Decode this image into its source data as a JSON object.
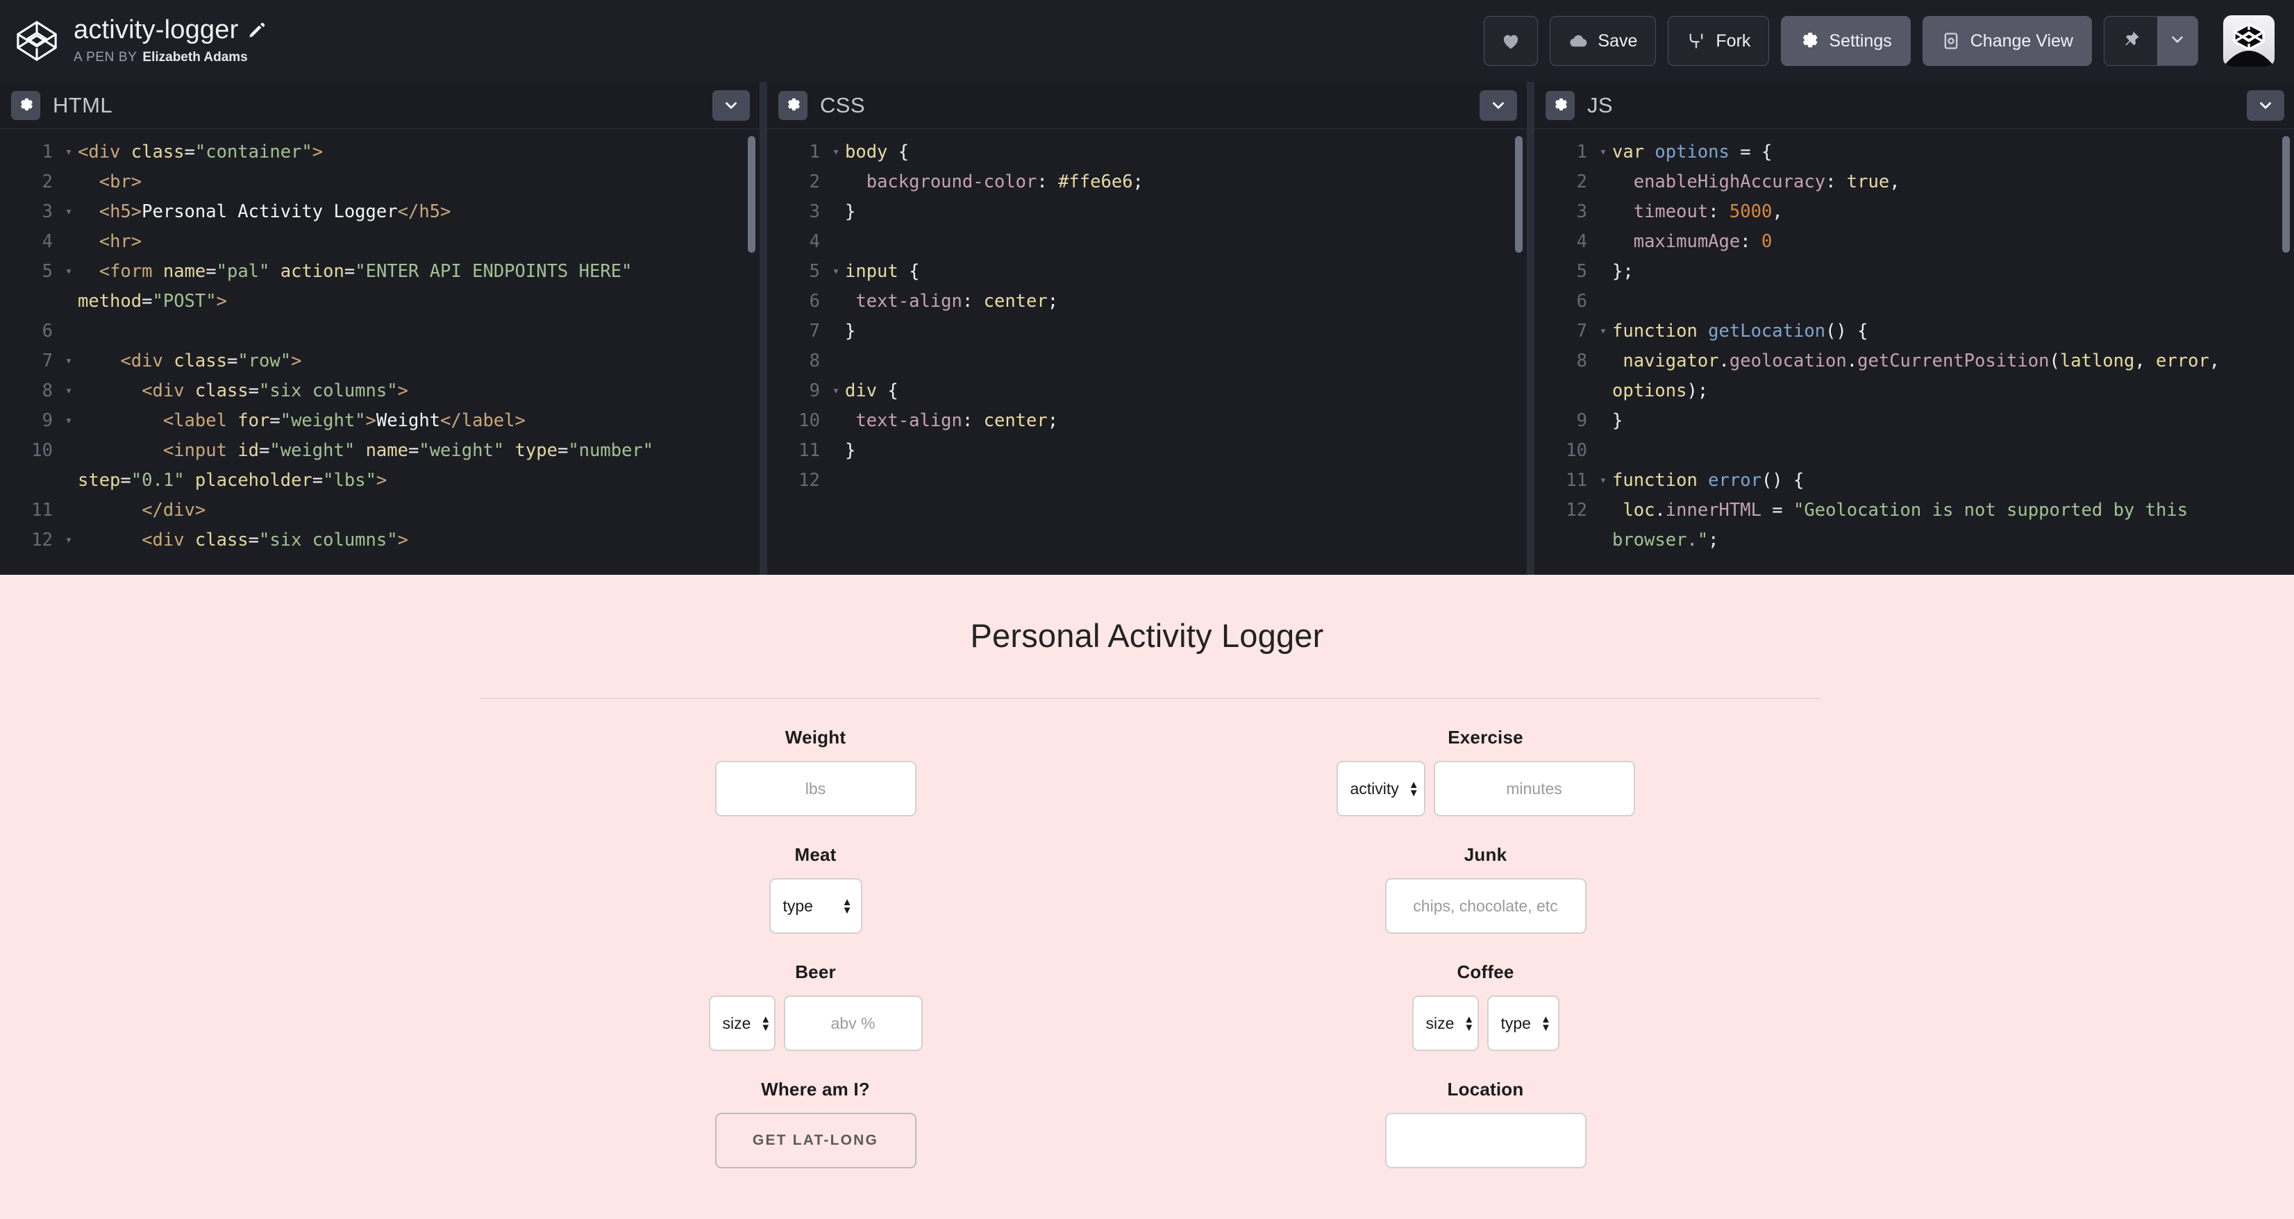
{
  "header": {
    "pen_title": "activity-logger",
    "byline_prefix": "A PEN BY",
    "author": "Elizabeth Adams",
    "edit_icon": "pencil-icon",
    "logo_icon": "codepen-logo-icon",
    "actions": {
      "love_label": "",
      "love_icon": "heart-icon",
      "save_label": "Save",
      "save_icon": "cloud-icon",
      "fork_label": "Fork",
      "fork_icon": "fork-icon",
      "settings_label": "Settings",
      "settings_icon": "gear-icon",
      "change_view_label": "Change View",
      "change_view_icon": "layout-icon",
      "pin_icon": "pin-icon",
      "pin_caret_icon": "chevron-down-icon",
      "avatar_label": "avatar"
    }
  },
  "editors": [
    {
      "id": "html",
      "title": "HTML",
      "gear_icon": "gear-icon",
      "collapse_icon": "chevron-down-icon",
      "lines": [
        {
          "n": "1",
          "fold": true,
          "tokens": [
            [
              "t-tag",
              "<div "
            ],
            [
              "t-attr",
              "class"
            ],
            [
              "t-punct",
              "="
            ],
            [
              "t-str",
              "\"container\""
            ],
            [
              "t-tag",
              ">"
            ]
          ]
        },
        {
          "n": "2",
          "fold": false,
          "tokens": [
            [
              "t-punct",
              "  "
            ],
            [
              "t-tag",
              "<br>"
            ]
          ]
        },
        {
          "n": "3",
          "fold": true,
          "tokens": [
            [
              "t-punct",
              "  "
            ],
            [
              "t-tag",
              "<h5>"
            ],
            [
              "t-txt",
              "Personal Activity Logger"
            ],
            [
              "t-tag",
              "</h5>"
            ]
          ]
        },
        {
          "n": "4",
          "fold": false,
          "tokens": [
            [
              "t-punct",
              "  "
            ],
            [
              "t-tag",
              "<hr>"
            ]
          ]
        },
        {
          "n": "5",
          "fold": true,
          "tokens": [
            [
              "t-punct",
              "  "
            ],
            [
              "t-tag",
              "<form "
            ],
            [
              "t-attr",
              "name"
            ],
            [
              "t-punct",
              "="
            ],
            [
              "t-str",
              "\"pal\""
            ],
            [
              "t-punct",
              " "
            ],
            [
              "t-attr",
              "action"
            ],
            [
              "t-punct",
              "="
            ],
            [
              "t-str",
              "\"ENTER API ENDPOINTS HERE\""
            ],
            [
              "t-punct",
              " "
            ],
            [
              "t-attr",
              "method"
            ],
            [
              "t-punct",
              "="
            ],
            [
              "t-str",
              "\"POST\""
            ],
            [
              "t-tag",
              ">"
            ]
          ]
        },
        {
          "n": "6",
          "fold": false,
          "tokens": [
            [
              "t-punct",
              ""
            ]
          ]
        },
        {
          "n": "7",
          "fold": true,
          "tokens": [
            [
              "t-punct",
              "    "
            ],
            [
              "t-tag",
              "<div "
            ],
            [
              "t-attr",
              "class"
            ],
            [
              "t-punct",
              "="
            ],
            [
              "t-str",
              "\"row\""
            ],
            [
              "t-tag",
              ">"
            ]
          ]
        },
        {
          "n": "8",
          "fold": true,
          "tokens": [
            [
              "t-punct",
              "      "
            ],
            [
              "t-tag",
              "<div "
            ],
            [
              "t-attr",
              "class"
            ],
            [
              "t-punct",
              "="
            ],
            [
              "t-str",
              "\"six columns\""
            ],
            [
              "t-tag",
              ">"
            ]
          ]
        },
        {
          "n": "9",
          "fold": true,
          "tokens": [
            [
              "t-punct",
              "        "
            ],
            [
              "t-tag",
              "<label "
            ],
            [
              "t-attr",
              "for"
            ],
            [
              "t-punct",
              "="
            ],
            [
              "t-str",
              "\"weight\""
            ],
            [
              "t-tag",
              ">"
            ],
            [
              "t-txt",
              "Weight"
            ],
            [
              "t-tag",
              "</label>"
            ]
          ]
        },
        {
          "n": "10",
          "fold": false,
          "tokens": [
            [
              "t-punct",
              "        "
            ],
            [
              "t-tag",
              "<input "
            ],
            [
              "t-attr",
              "id"
            ],
            [
              "t-punct",
              "="
            ],
            [
              "t-str",
              "\"weight\""
            ],
            [
              "t-punct",
              " "
            ],
            [
              "t-attr",
              "name"
            ],
            [
              "t-punct",
              "="
            ],
            [
              "t-str",
              "\"weight\""
            ],
            [
              "t-punct",
              " "
            ],
            [
              "t-attr",
              "type"
            ],
            [
              "t-punct",
              "="
            ],
            [
              "t-str",
              "\"number\""
            ],
            [
              "t-punct",
              " "
            ],
            [
              "t-attr",
              "step"
            ],
            [
              "t-punct",
              "="
            ],
            [
              "t-str",
              "\"0.1\""
            ],
            [
              "t-punct",
              " "
            ],
            [
              "t-attr",
              "placeholder"
            ],
            [
              "t-punct",
              "="
            ],
            [
              "t-str",
              "\"lbs\""
            ],
            [
              "t-tag",
              ">"
            ]
          ]
        },
        {
          "n": "11",
          "fold": false,
          "tokens": [
            [
              "t-punct",
              "      "
            ],
            [
              "t-tag",
              "</div>"
            ]
          ]
        },
        {
          "n": "12",
          "fold": true,
          "tokens": [
            [
              "t-punct",
              "      "
            ],
            [
              "t-tag",
              "<div "
            ],
            [
              "t-attr",
              "class"
            ],
            [
              "t-punct",
              "="
            ],
            [
              "t-str",
              "\"six columns\""
            ],
            [
              "t-tag",
              ">"
            ]
          ]
        }
      ]
    },
    {
      "id": "css",
      "title": "CSS",
      "gear_icon": "gear-icon",
      "collapse_icon": "chevron-down-icon",
      "lines": [
        {
          "n": "1",
          "fold": true,
          "tokens": [
            [
              "t-sel",
              "body"
            ],
            [
              "t-punct",
              " {"
            ]
          ]
        },
        {
          "n": "2",
          "fold": false,
          "tokens": [
            [
              "t-punct",
              "  "
            ],
            [
              "t-prop",
              "background-color"
            ],
            [
              "t-punct",
              ": "
            ],
            [
              "t-val",
              "#ffe6e6"
            ],
            [
              "t-punct",
              ";"
            ]
          ]
        },
        {
          "n": "3",
          "fold": false,
          "tokens": [
            [
              "t-punct",
              "}"
            ]
          ]
        },
        {
          "n": "4",
          "fold": false,
          "tokens": [
            [
              "t-punct",
              ""
            ]
          ]
        },
        {
          "n": "5",
          "fold": true,
          "tokens": [
            [
              "t-sel",
              "input"
            ],
            [
              "t-punct",
              " {"
            ]
          ]
        },
        {
          "n": "6",
          "fold": false,
          "tokens": [
            [
              "t-punct",
              " "
            ],
            [
              "t-prop",
              "text-align"
            ],
            [
              "t-punct",
              ": "
            ],
            [
              "t-val",
              "center"
            ],
            [
              "t-punct",
              ";"
            ]
          ]
        },
        {
          "n": "7",
          "fold": false,
          "tokens": [
            [
              "t-punct",
              "}"
            ]
          ]
        },
        {
          "n": "8",
          "fold": false,
          "tokens": [
            [
              "t-punct",
              ""
            ]
          ]
        },
        {
          "n": "9",
          "fold": true,
          "tokens": [
            [
              "t-sel",
              "div"
            ],
            [
              "t-punct",
              " {"
            ]
          ]
        },
        {
          "n": "10",
          "fold": false,
          "tokens": [
            [
              "t-punct",
              " "
            ],
            [
              "t-prop",
              "text-align"
            ],
            [
              "t-punct",
              ": "
            ],
            [
              "t-val",
              "center"
            ],
            [
              "t-punct",
              ";"
            ]
          ]
        },
        {
          "n": "11",
          "fold": false,
          "tokens": [
            [
              "t-punct",
              "}"
            ]
          ]
        },
        {
          "n": "12",
          "fold": false,
          "tokens": [
            [
              "t-punct",
              ""
            ]
          ]
        }
      ]
    },
    {
      "id": "js",
      "title": "JS",
      "gear_icon": "gear-icon",
      "collapse_icon": "chevron-down-icon",
      "lines": [
        {
          "n": "1",
          "fold": true,
          "tokens": [
            [
              "t-kw",
              "var "
            ],
            [
              "t-fn",
              "options"
            ],
            [
              "t-punct",
              " = {"
            ]
          ]
        },
        {
          "n": "2",
          "fold": false,
          "tokens": [
            [
              "t-punct",
              "  "
            ],
            [
              "t-mem",
              "enableHighAccuracy"
            ],
            [
              "t-punct",
              ": "
            ],
            [
              "t-kw",
              "true"
            ],
            [
              "t-punct",
              ","
            ]
          ]
        },
        {
          "n": "3",
          "fold": false,
          "tokens": [
            [
              "t-punct",
              "  "
            ],
            [
              "t-mem",
              "timeout"
            ],
            [
              "t-punct",
              ": "
            ],
            [
              "t-num",
              "5000"
            ],
            [
              "t-punct",
              ","
            ]
          ]
        },
        {
          "n": "4",
          "fold": false,
          "tokens": [
            [
              "t-punct",
              "  "
            ],
            [
              "t-mem",
              "maximumAge"
            ],
            [
              "t-punct",
              ": "
            ],
            [
              "t-num",
              "0"
            ]
          ]
        },
        {
          "n": "5",
          "fold": false,
          "tokens": [
            [
              "t-punct",
              "};"
            ]
          ]
        },
        {
          "n": "6",
          "fold": false,
          "tokens": [
            [
              "t-punct",
              ""
            ]
          ]
        },
        {
          "n": "7",
          "fold": true,
          "tokens": [
            [
              "t-kw",
              "function "
            ],
            [
              "t-fn",
              "getLocation"
            ],
            [
              "t-punct",
              "() {"
            ]
          ]
        },
        {
          "n": "8",
          "fold": false,
          "tokens": [
            [
              "t-punct",
              " "
            ],
            [
              "t-ident",
              "navigator"
            ],
            [
              "t-punct",
              "."
            ],
            [
              "t-mem",
              "geolocation"
            ],
            [
              "t-punct",
              "."
            ],
            [
              "t-mem",
              "getCurrentPosition"
            ],
            [
              "t-punct",
              "("
            ],
            [
              "t-ident",
              "latlong"
            ],
            [
              "t-punct",
              ", "
            ],
            [
              "t-ident",
              "error"
            ],
            [
              "t-punct",
              ", "
            ],
            [
              "t-ident",
              "options"
            ],
            [
              "t-punct",
              ");"
            ]
          ]
        },
        {
          "n": "9",
          "fold": false,
          "tokens": [
            [
              "t-punct",
              "}"
            ]
          ]
        },
        {
          "n": "10",
          "fold": false,
          "tokens": [
            [
              "t-punct",
              ""
            ]
          ]
        },
        {
          "n": "11",
          "fold": true,
          "tokens": [
            [
              "t-kw",
              "function "
            ],
            [
              "t-fn",
              "error"
            ],
            [
              "t-punct",
              "() {"
            ]
          ]
        },
        {
          "n": "12",
          "fold": false,
          "tokens": [
            [
              "t-punct",
              " "
            ],
            [
              "t-ident",
              "loc"
            ],
            [
              "t-punct",
              "."
            ],
            [
              "t-mem",
              "innerHTML"
            ],
            [
              "t-punct",
              " = "
            ],
            [
              "t-str",
              "\"Geolocation is not supported by this browser.\""
            ],
            [
              "t-punct",
              ";"
            ]
          ]
        }
      ]
    }
  ],
  "preview": {
    "title": "Personal Activity Logger",
    "rows": [
      {
        "left": {
          "label": "Weight",
          "controls": [
            {
              "kind": "input",
              "placeholder": "lbs",
              "width": "w-weight"
            }
          ]
        },
        "right": {
          "label": "Exercise",
          "controls": [
            {
              "kind": "select",
              "value": "activity",
              "width": "w-activity"
            },
            {
              "kind": "input",
              "placeholder": "minutes",
              "width": "w-minutes"
            }
          ]
        }
      },
      {
        "left": {
          "label": "Meat",
          "controls": [
            {
              "kind": "select",
              "value": "type",
              "width": "w-type"
            }
          ]
        },
        "right": {
          "label": "Junk",
          "controls": [
            {
              "kind": "input",
              "placeholder": "chips, chocolate, etc",
              "width": "w-junk"
            }
          ]
        }
      },
      {
        "left": {
          "label": "Beer",
          "controls": [
            {
              "kind": "select",
              "value": "size",
              "width": "w-size"
            },
            {
              "kind": "input",
              "placeholder": "abv %",
              "width": "w-abv"
            }
          ]
        },
        "right": {
          "label": "Coffee",
          "controls": [
            {
              "kind": "select",
              "value": "size",
              "width": "w-csize"
            },
            {
              "kind": "select",
              "value": "type",
              "width": "w-ctype"
            }
          ]
        }
      },
      {
        "left": {
          "label": "Where am I?",
          "controls": [
            {
              "kind": "button",
              "value": "Get Lat-Long",
              "width": ""
            }
          ]
        },
        "right": {
          "label": "Location",
          "controls": [
            {
              "kind": "input",
              "placeholder": "",
              "width": "w-location"
            }
          ]
        }
      }
    ]
  },
  "colors": {
    "chrome_bg": "#1e1f26",
    "editor_bg": "#1c1d23",
    "gutter_bg": "#2b2d38",
    "accent_button": "#565868",
    "preview_bg": "#ffe6e6"
  }
}
